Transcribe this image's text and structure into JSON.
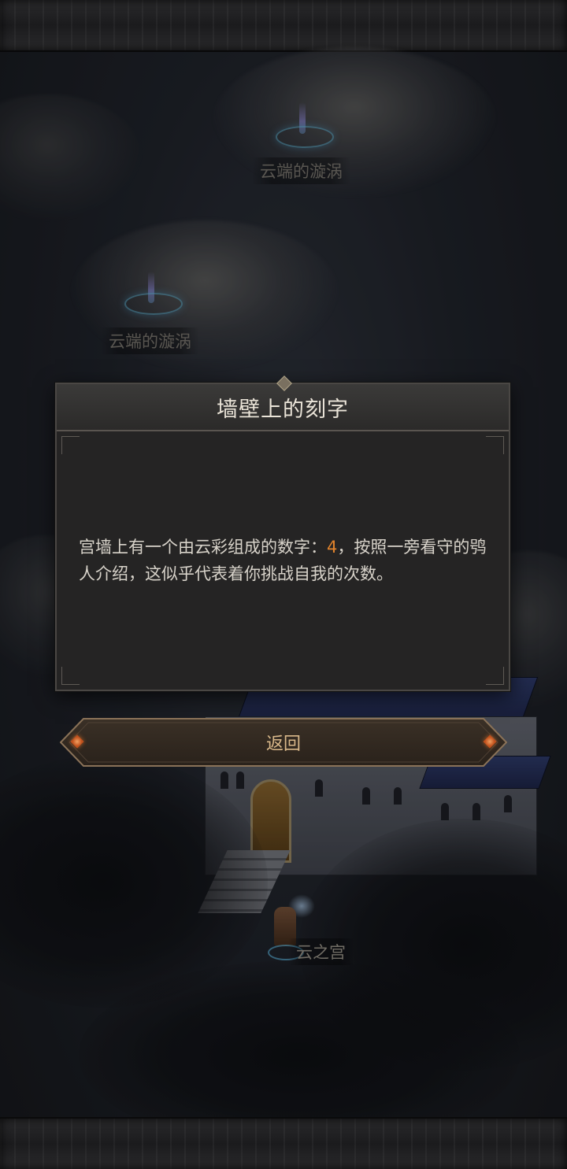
{
  "map": {
    "locations": [
      {
        "label": "云端的漩涡"
      },
      {
        "label": "云端的漩涡"
      },
      {
        "label": "云之宫"
      }
    ]
  },
  "dialog": {
    "title": "墙壁上的刻字",
    "body_before": "宫墙上有一个由云彩组成的数字：",
    "highlight": "4",
    "body_after": "，按照一旁看守的鸮人介绍，这似乎代表着你挑战自我的次数。"
  },
  "return_button": {
    "label": "返回"
  },
  "colors": {
    "highlight": "#e0832c",
    "button_text": "#d9b88a",
    "title_text": "#eae4d8"
  }
}
